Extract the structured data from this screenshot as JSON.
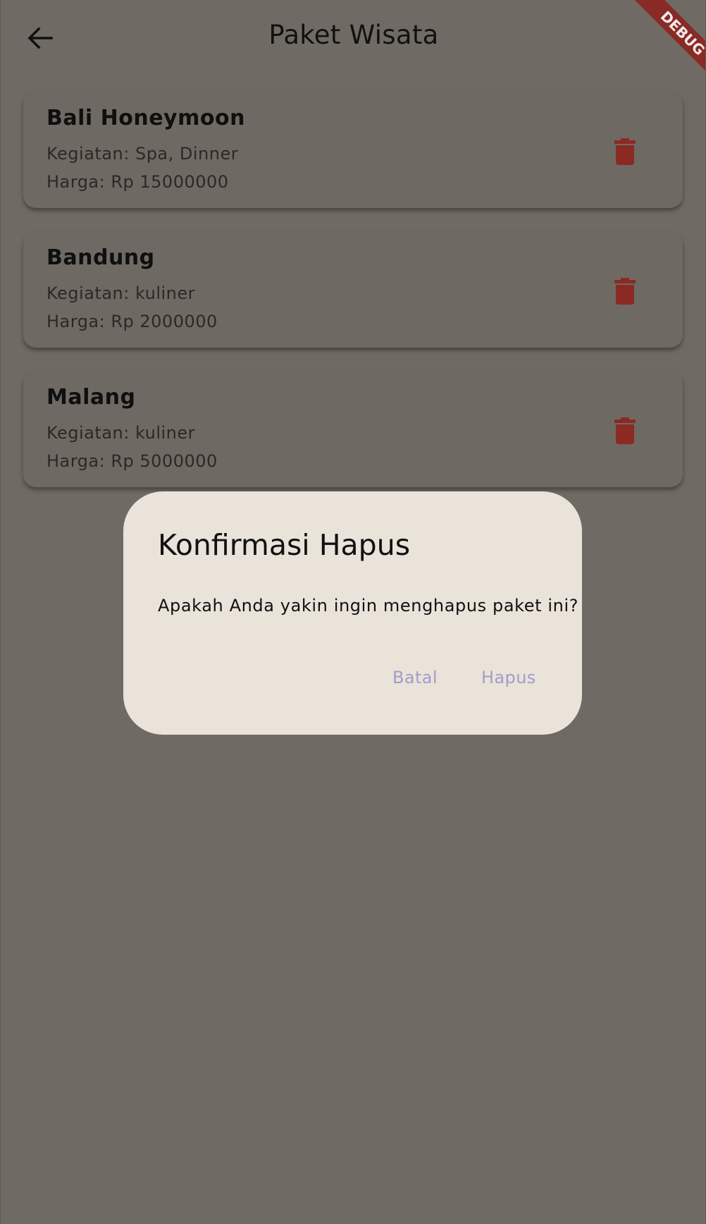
{
  "appbar": {
    "title": "Paket Wisata",
    "back_icon": "arrow-left-icon",
    "debug_label": "DEBUG"
  },
  "packages": [
    {
      "name": "Bali Honeymoon",
      "activities": "Kegiatan: Spa, Dinner",
      "price": "Harga: Rp 15000000"
    },
    {
      "name": "Bandung",
      "activities": "Kegiatan: kuliner",
      "price": "Harga: Rp 2000000"
    },
    {
      "name": "Malang",
      "activities": "Kegiatan: kuliner",
      "price": "Harga: Rp 5000000"
    }
  ],
  "dialog": {
    "title": "Konfirmasi Hapus",
    "message": "Apakah Anda yakin ingin menghapus paket ini?",
    "cancel_label": "Batal",
    "confirm_label": "Hapus"
  },
  "colors": {
    "scrim_background": "#6f6b64",
    "dialog_background": "#e9e3da",
    "delete_icon": "#8a2a22",
    "dialog_button_text": "#a59cc9",
    "debug_ribbon": "#8a2a26"
  },
  "icons": {
    "delete": "trash-icon"
  }
}
